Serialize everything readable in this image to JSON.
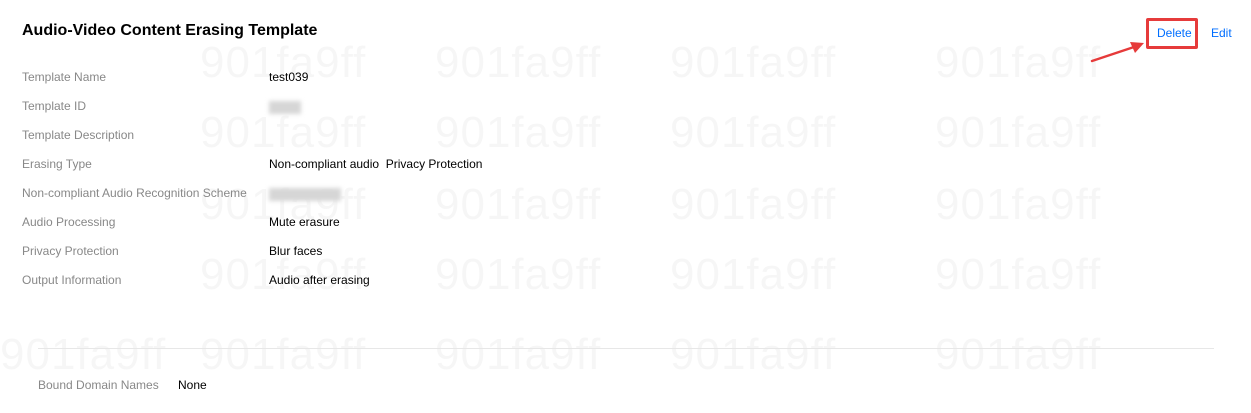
{
  "header": {
    "title": "Audio-Video Content Erasing Template"
  },
  "actions": {
    "delete_label": "Delete",
    "edit_label": "Edit"
  },
  "details": [
    {
      "label": "Template Name",
      "value": "test039"
    },
    {
      "label": "Template ID",
      "value": ""
    },
    {
      "label": "Template Description",
      "value": ""
    },
    {
      "label": "Erasing Type",
      "value": "Non-compliant audio  Privacy Protection"
    },
    {
      "label": "Non-compliant Audio Recognition Scheme",
      "value": ""
    },
    {
      "label": "Audio Processing",
      "value": "Mute erasure"
    },
    {
      "label": "Privacy Protection",
      "value": "Blur faces"
    },
    {
      "label": "Output Information",
      "value": "Audio after erasing"
    }
  ],
  "bound": {
    "label": "Bound Domain Names",
    "value": "None"
  },
  "watermark": {
    "text": "901fa9ff"
  },
  "colors": {
    "link": "#006eff",
    "highlight": "#e63b3b",
    "label": "#888888"
  }
}
